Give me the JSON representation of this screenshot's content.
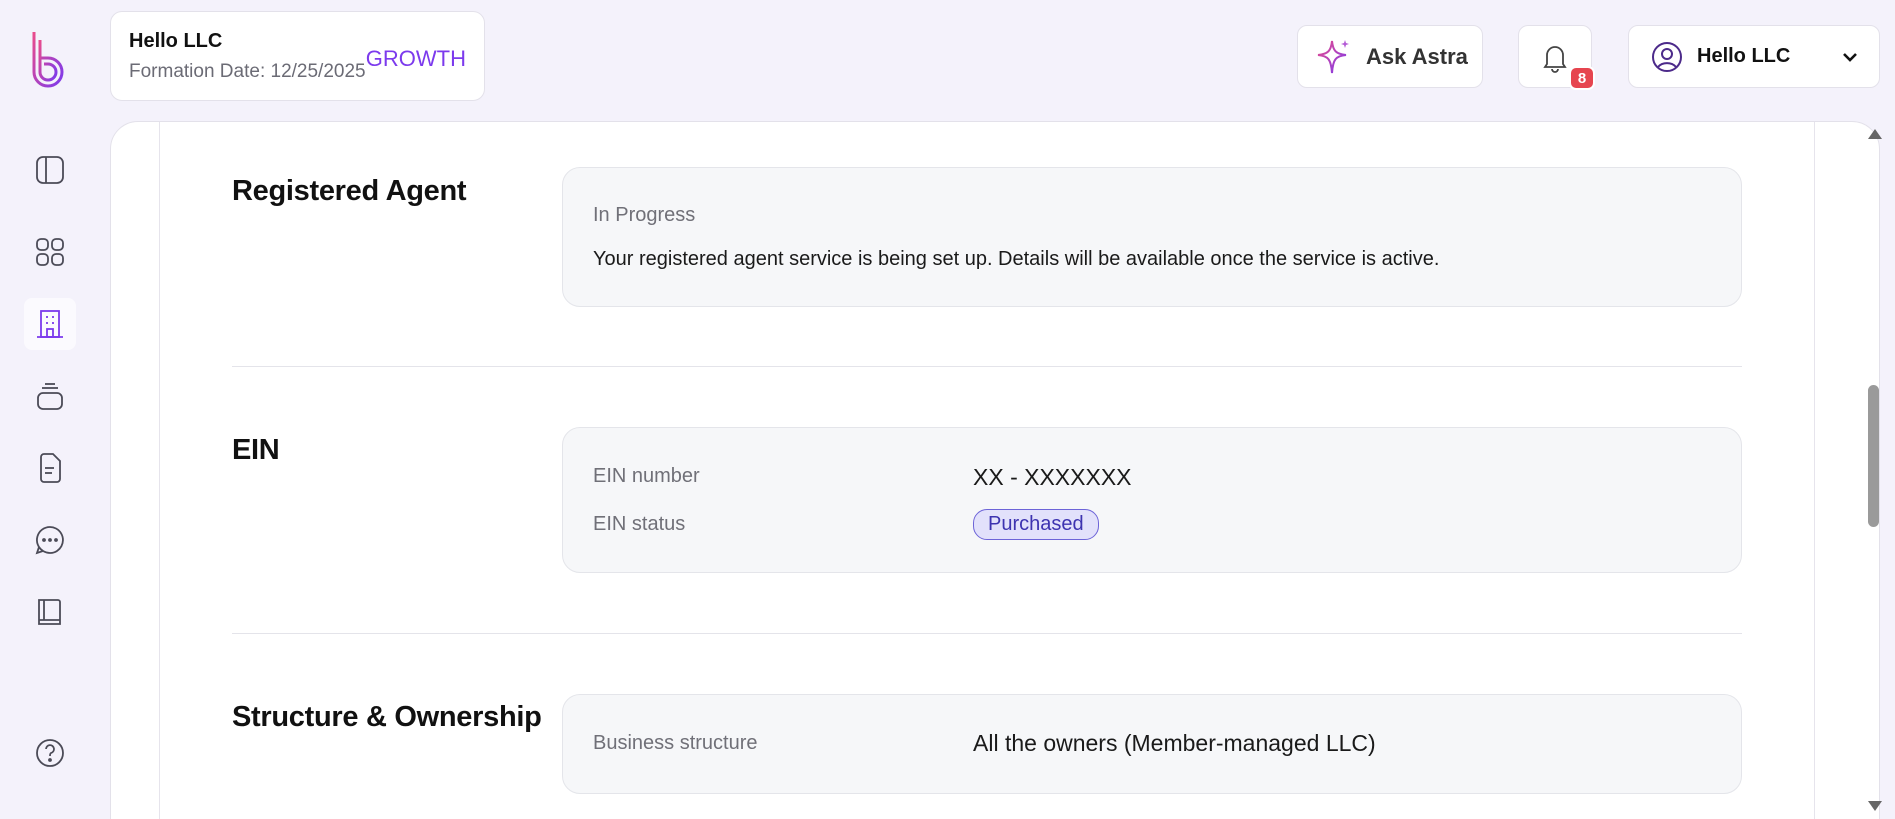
{
  "company": {
    "name": "Hello LLC",
    "formation_date": "Formation Date: 12/25/2025",
    "plan": "GROWTH"
  },
  "header": {
    "ask_astra": "Ask Astra",
    "notifications_count": "8",
    "user_name": "Hello LLC"
  },
  "sidebar": {
    "items": [
      {
        "icon": "sidebar-toggle-icon"
      },
      {
        "icon": "dashboard-grid-icon"
      },
      {
        "icon": "building-icon",
        "active": true
      },
      {
        "icon": "stack-icon"
      },
      {
        "icon": "document-icon"
      },
      {
        "icon": "chat-icon"
      },
      {
        "icon": "book-icon"
      },
      {
        "icon": "help-icon"
      }
    ]
  },
  "sections": {
    "registered_agent": {
      "title": "Registered Agent",
      "status": "In Progress",
      "description": "Your registered agent service is being set up. Details will be available once the service is active."
    },
    "ein": {
      "title": "EIN",
      "number_label": "EIN number",
      "number_value": "XX - XXXXXXX",
      "status_label": "EIN status",
      "status_value": "Purchased"
    },
    "structure": {
      "title": "Structure & Ownership",
      "business_structure_label": "Business structure",
      "business_structure_value": "All the owners (Member-managed LLC)"
    }
  },
  "colors": {
    "accent": "#7c3aed",
    "badge": "#e6454f",
    "pill_bg": "#e2e1fb",
    "pill_border": "#6d64d8"
  }
}
